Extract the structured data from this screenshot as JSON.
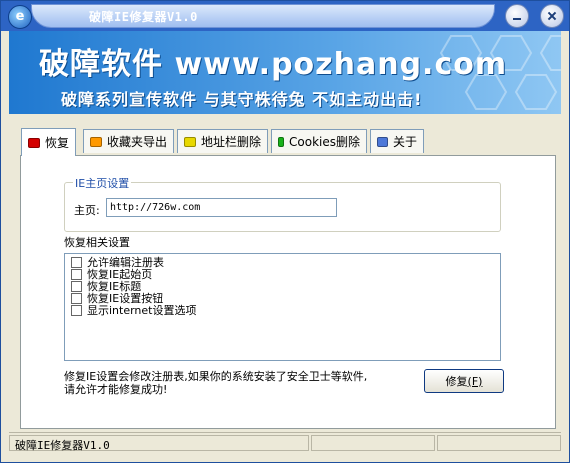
{
  "window": {
    "title": "破障IE修复器V1.0",
    "logo_letter": "e"
  },
  "banner": {
    "main": "破障软件 www.pozhang.com",
    "sub": "破障系列宣传软件 与其守株待兔 不如主动出击!"
  },
  "tabs": [
    {
      "label": "恢复",
      "color": "#d40000"
    },
    {
      "label": "收藏夹导出",
      "color": "#ff9900"
    },
    {
      "label": "地址栏删除",
      "color": "#e8d800"
    },
    {
      "label": "Cookies删除",
      "color": "#19b21b"
    },
    {
      "label": "关于",
      "color": "#4d78d8"
    }
  ],
  "home": {
    "group_label": "IE主页设置",
    "label": "主页:",
    "value": "http://726w.com"
  },
  "restore": {
    "label": "恢复相关设置",
    "options": [
      "允许编辑注册表",
      "恢复IE起始页",
      "恢复IE标题",
      "恢复IE设置按钮",
      "显示internet设置选项"
    ]
  },
  "note": {
    "line1": "修复IE设置会修改注册表,如果你的系统安装了安全卫士等软件,",
    "line2": "请允许才能修复成功!"
  },
  "repair_button": {
    "label": "修复",
    "hotkey": "(F)"
  },
  "status": {
    "text": "破障IE修复器V1.0"
  }
}
